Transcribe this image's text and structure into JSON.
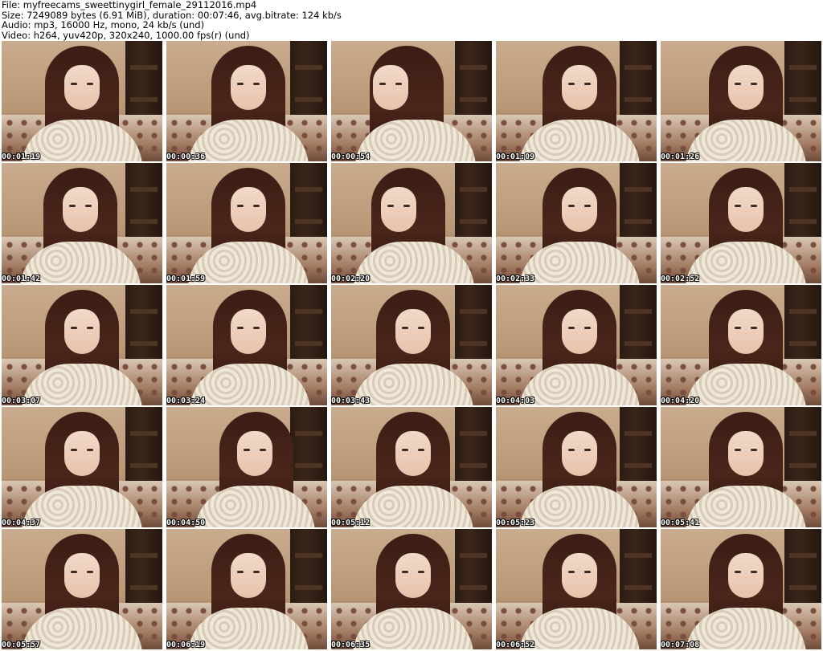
{
  "header": {
    "file_line": "File: myfreecams_sweettinygirl_female_29112016.mp4",
    "size_line": "Size: 7249089 bytes (6.91 MiB), duration: 00:07:46, avg.bitrate: 124 kb/s",
    "audio_line": "Audio: mp3, 16000 Hz, mono, 24 kb/s (und)",
    "video_line": "Video: h264, yuv420p, 320x240, 1000.00 fps(r) (und)"
  },
  "thumbnails": [
    {
      "time": "00:01:19"
    },
    {
      "time": "00:00:36"
    },
    {
      "time": "00:00:54"
    },
    {
      "time": "00:01:09"
    },
    {
      "time": "00:01:26"
    },
    {
      "time": "00:01:42"
    },
    {
      "time": "00:01:59"
    },
    {
      "time": "00:02:20"
    },
    {
      "time": "00:02:33"
    },
    {
      "time": "00:02:52"
    },
    {
      "time": "00:03:07"
    },
    {
      "time": "00:03:24"
    },
    {
      "time": "00:03:43"
    },
    {
      "time": "00:04:03"
    },
    {
      "time": "00:04:20"
    },
    {
      "time": "00:04:37"
    },
    {
      "time": "00:04:50"
    },
    {
      "time": "00:05:12"
    },
    {
      "time": "00:05:23"
    },
    {
      "time": "00:05:41"
    },
    {
      "time": "00:05:57"
    },
    {
      "time": "00:06:19"
    },
    {
      "time": "00:06:35"
    },
    {
      "time": "00:06:52"
    },
    {
      "time": "00:07:08"
    }
  ]
}
